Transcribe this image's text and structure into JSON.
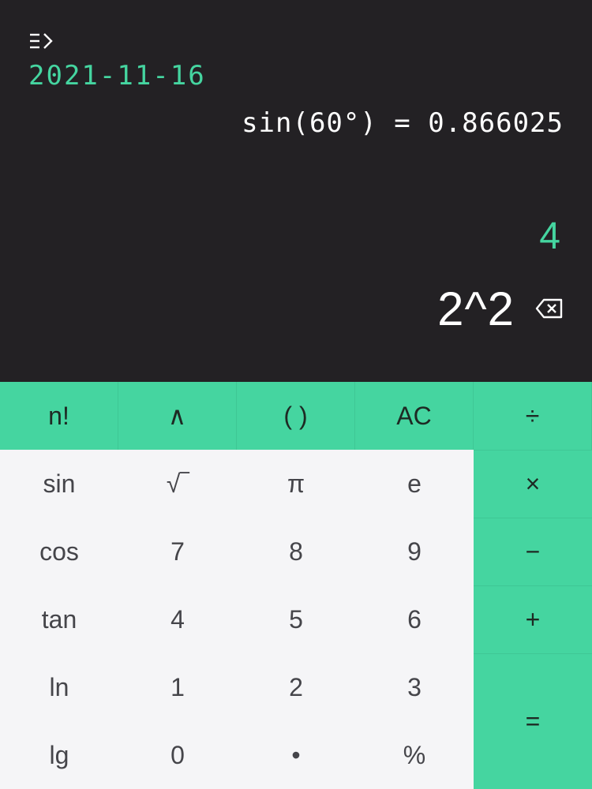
{
  "display": {
    "history_icon": "history-list-icon",
    "date": "2021-11-16",
    "history_expression": "sin(60°) = 0.866025",
    "result": "4",
    "expression": "2^2",
    "backspace_icon": "backspace-icon"
  },
  "keys": {
    "top": [
      "n!",
      "∧",
      "( )",
      "AC",
      "÷"
    ],
    "row1": [
      "sin",
      "√‾",
      "π",
      "e",
      "×"
    ],
    "row2": [
      "cos",
      "7",
      "8",
      "9",
      "−"
    ],
    "row3": [
      "tan",
      "4",
      "5",
      "6",
      "+"
    ],
    "row4": [
      "ln",
      "1",
      "2",
      "3",
      "="
    ],
    "row5": [
      "lg",
      "0",
      "•",
      "%"
    ]
  },
  "colors": {
    "accent": "#45d5a0",
    "display_bg": "#232124",
    "keypad_bg": "#f5f5f7"
  }
}
